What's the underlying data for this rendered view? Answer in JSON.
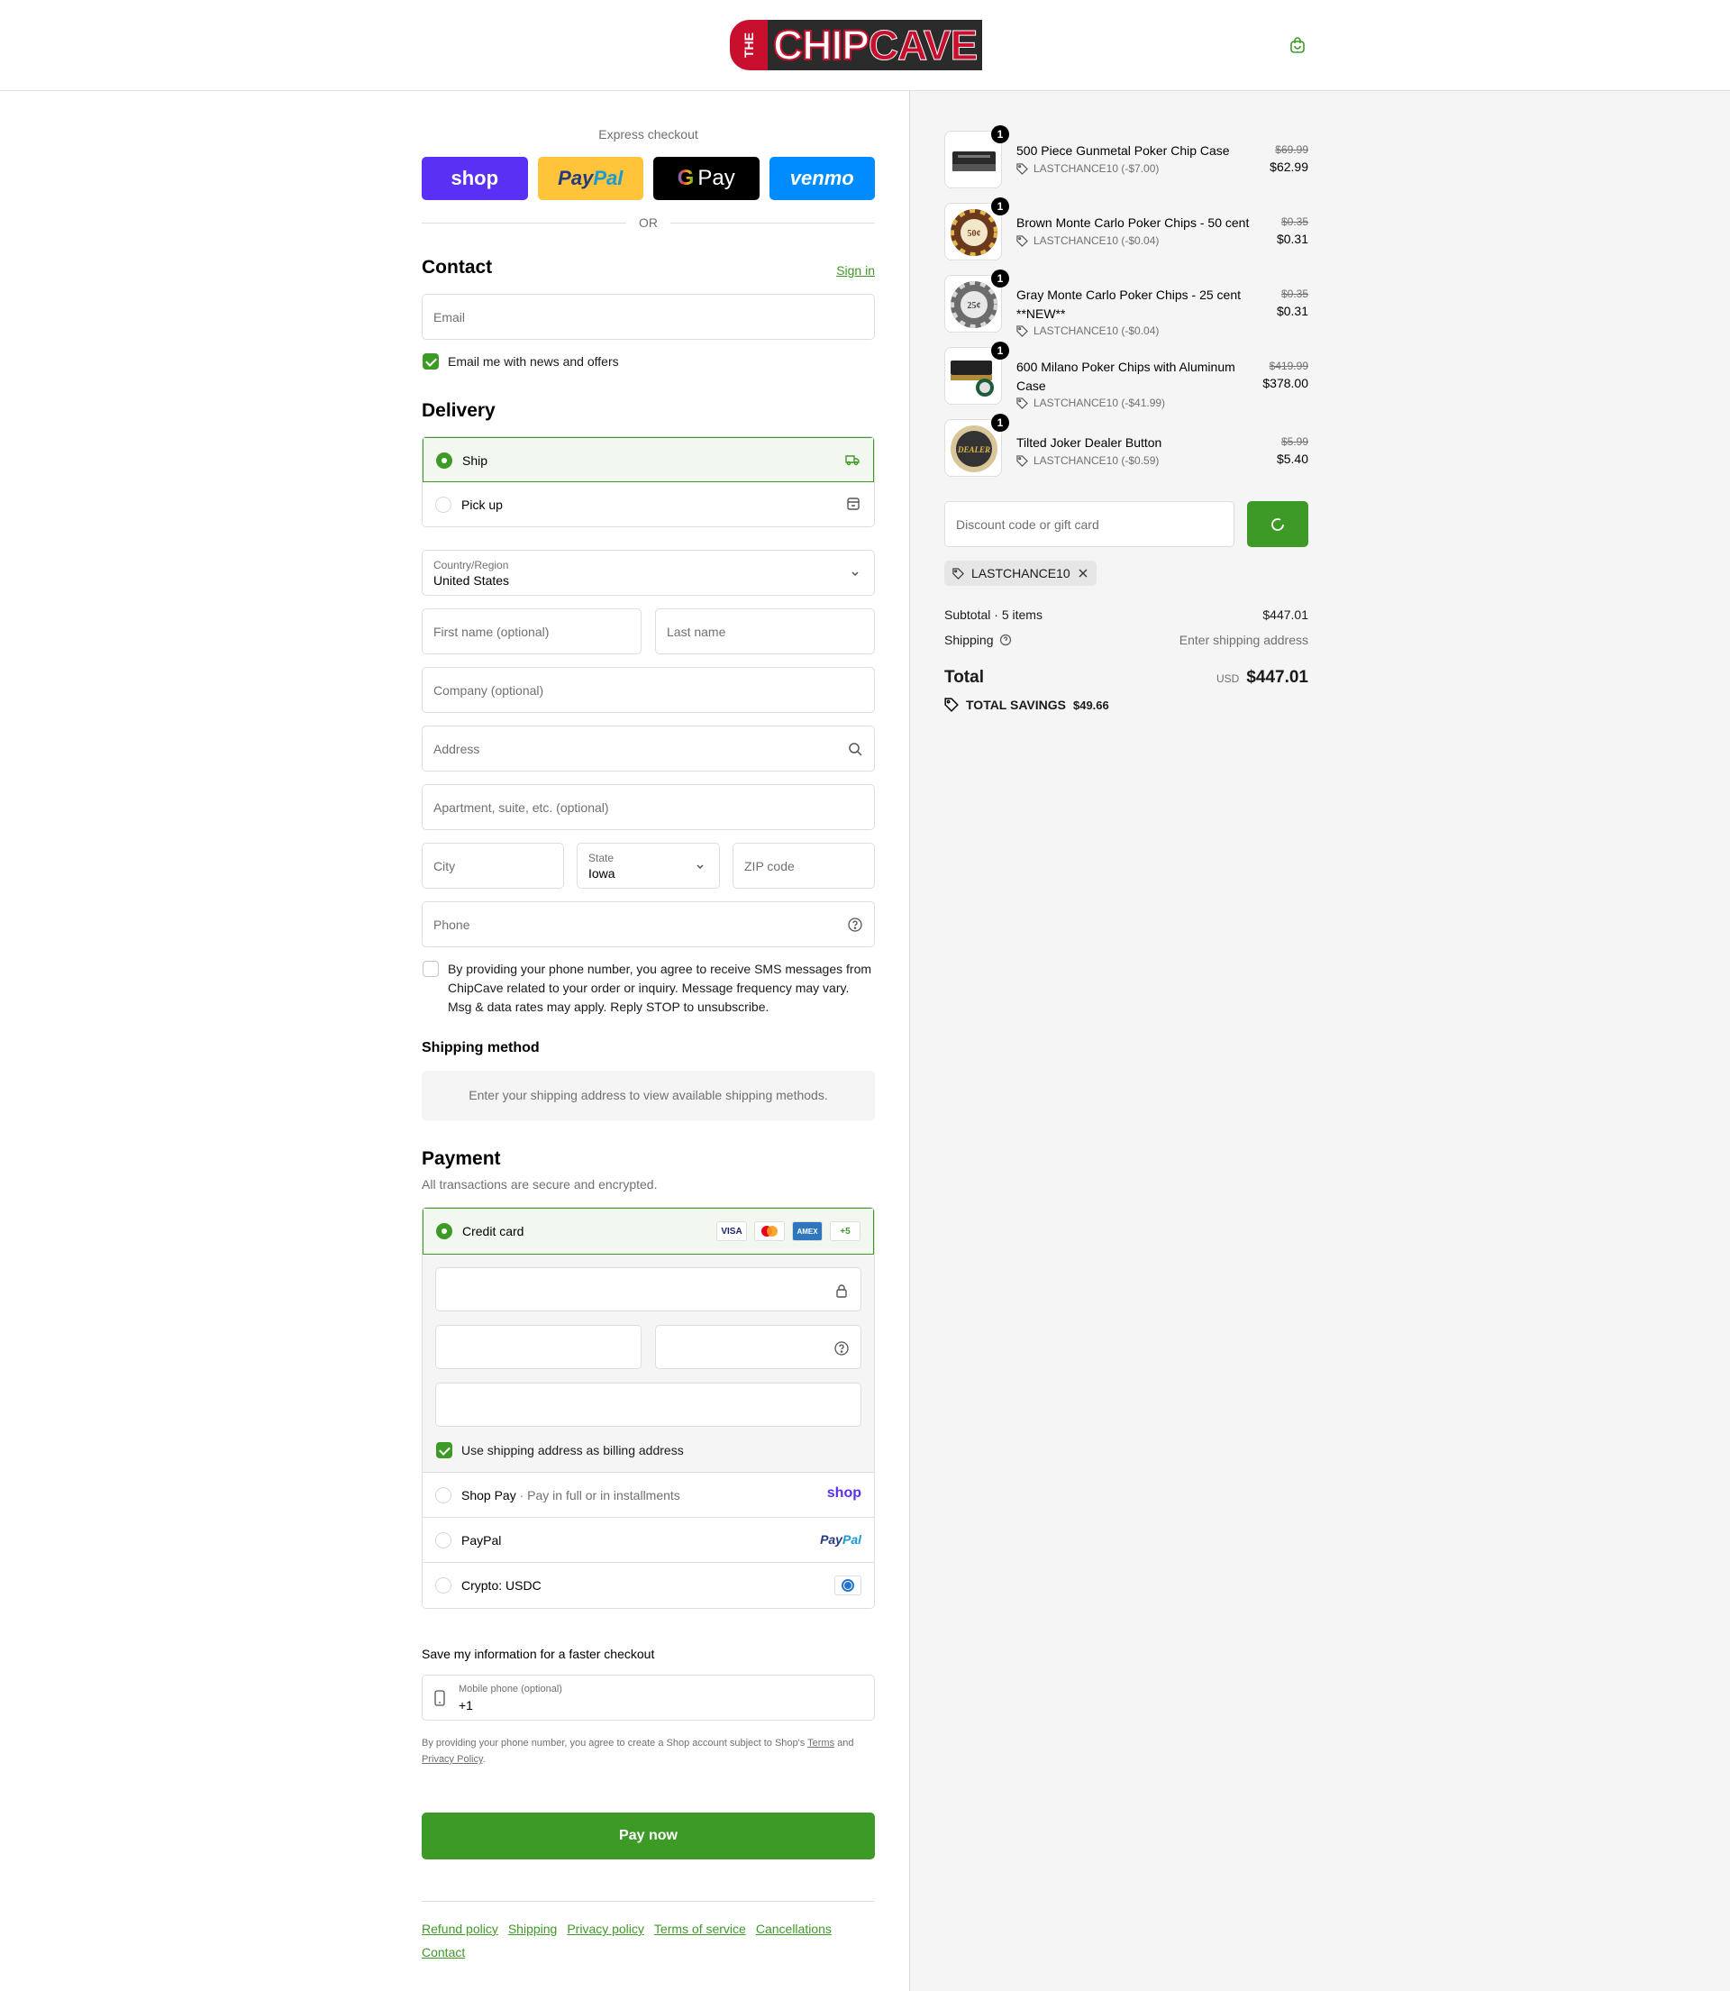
{
  "header": {
    "logo_text_the": "THE",
    "logo_text_chip": "CHIP",
    "logo_text_cave": "CAVE"
  },
  "express": {
    "title": "Express checkout",
    "shop": "shop",
    "paypal_a": "Pay",
    "paypal_b": "Pal",
    "gpay_g": "G",
    "gpay": "Pay",
    "venmo": "venmo",
    "or": "OR"
  },
  "contact": {
    "title": "Contact",
    "sign_in": "Sign in",
    "email_placeholder": "Email",
    "news_label": "Email me with news and offers"
  },
  "delivery": {
    "title": "Delivery",
    "ship": "Ship",
    "pickup": "Pick up",
    "country_label": "Country/Region",
    "country_value": "United States",
    "first_name": "First name (optional)",
    "last_name": "Last name",
    "company": "Company (optional)",
    "address": "Address",
    "apartment": "Apartment, suite, etc. (optional)",
    "city": "City",
    "state_label": "State",
    "state_value": "Iowa",
    "zip": "ZIP code",
    "phone": "Phone",
    "sms_consent": "By providing your phone number, you agree to receive SMS messages from ChipCave related to your order or inquiry. Message frequency may vary. Msg & data rates may apply. Reply STOP to unsubscribe."
  },
  "shipping_method": {
    "title": "Shipping method",
    "notice": "Enter your shipping address to view available shipping methods."
  },
  "payment": {
    "title": "Payment",
    "subtitle": "All transactions are secure and encrypted.",
    "credit_card": "Credit card",
    "card_visa": "VISA",
    "card_amex": "AMEX",
    "card_more": "+5",
    "billing_same": "Use shipping address as billing address",
    "shop_pay": "Shop Pay",
    "shop_pay_sep": "·",
    "shop_pay_sub": "Pay in full or in installments",
    "shop_pay_logo": "shop",
    "paypal": "PayPal",
    "paypal_logo_a": "Pay",
    "paypal_logo_b": "Pal",
    "crypto": "Crypto: USDC"
  },
  "save_info": {
    "title": "Save my information for a faster checkout",
    "mobile_label": "Mobile phone (optional)",
    "mobile_value": "+1",
    "legal_a": "By providing your phone number, you agree to create a Shop account subject to Shop's ",
    "terms": "Terms",
    "legal_b": " and ",
    "privacy": "Privacy Policy",
    "legal_c": "."
  },
  "pay_now": "Pay now",
  "footer": {
    "links": [
      "Refund policy",
      "Shipping",
      "Privacy policy",
      "Terms of service",
      "Cancellations",
      "Contact"
    ]
  },
  "summary": {
    "items": [
      {
        "qty": "1",
        "name": "500 Piece Gunmetal Poker Chip Case",
        "discount": "LASTCHANCE10 (-$7.00)",
        "old_price": "$69.99",
        "price": "$62.99"
      },
      {
        "qty": "1",
        "name": "Brown Monte Carlo Poker Chips - 50 cent",
        "discount": "LASTCHANCE10 (-$0.04)",
        "old_price": "$0.35",
        "price": "$0.31"
      },
      {
        "qty": "1",
        "name": "Gray Monte Carlo Poker Chips - 25 cent **NEW**",
        "discount": "LASTCHANCE10 (-$0.04)",
        "old_price": "$0.35",
        "price": "$0.31"
      },
      {
        "qty": "1",
        "name": "600 Milano Poker Chips with Aluminum Case",
        "discount": "LASTCHANCE10 (-$41.99)",
        "old_price": "$419.99",
        "price": "$378.00"
      },
      {
        "qty": "1",
        "name": "Tilted Joker Dealer Button",
        "discount": "LASTCHANCE10 (-$0.59)",
        "old_price": "$5.99",
        "price": "$5.40"
      }
    ],
    "chip_50_label": "50¢",
    "chip_25_label": "25¢",
    "dealer_label": "DEALER",
    "discount_placeholder": "Discount code or gift card",
    "applied_code": "LASTCHANCE10",
    "subtotal_label": "Subtotal · 5 items",
    "subtotal_value": "$447.01",
    "shipping_label": "Shipping",
    "shipping_value": "Enter shipping address",
    "total_label": "Total",
    "currency": "USD",
    "total_value": "$447.01",
    "savings_label": "TOTAL SAVINGS",
    "savings_value": "$49.66"
  },
  "colors": {
    "accent": "#3e9a27",
    "shop": "#5a31f4",
    "paypal": "#ffc439",
    "venmo": "#008cff"
  }
}
